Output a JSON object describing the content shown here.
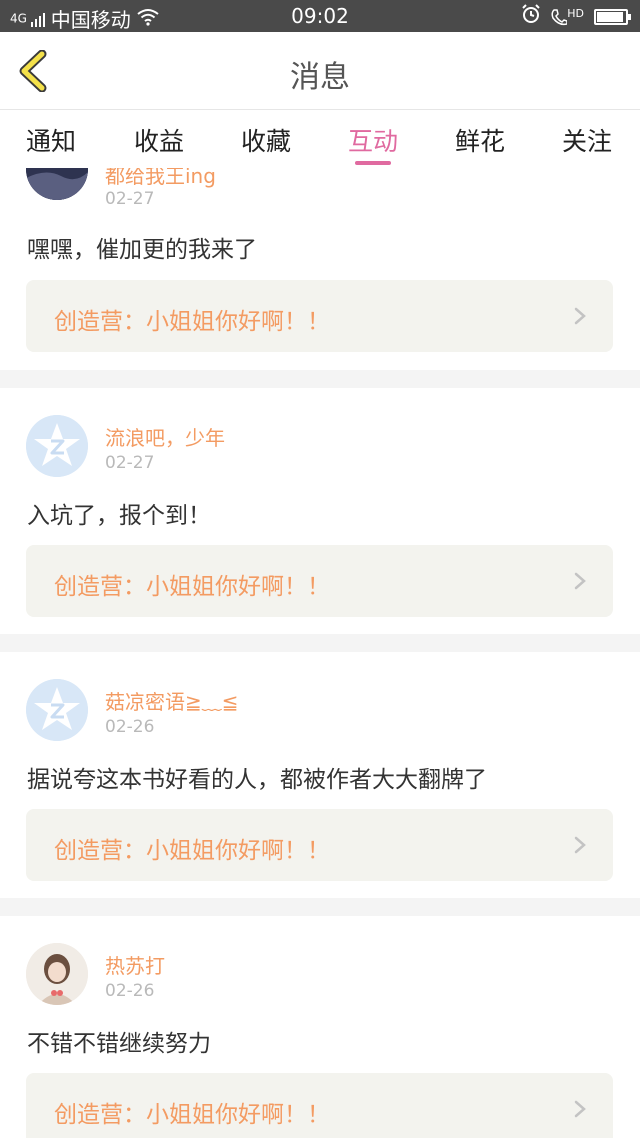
{
  "status_bar": {
    "network": "4G",
    "carrier": "中国移动",
    "time": "09:02",
    "hd_label": "HD",
    "battery_level": 0.85
  },
  "header": {
    "title": "消息",
    "back_icon": "chevron-left-icon"
  },
  "tabs": [
    {
      "label": "通知",
      "active": false
    },
    {
      "label": "收益",
      "active": false
    },
    {
      "label": "收藏",
      "active": false
    },
    {
      "label": "互动",
      "active": true
    },
    {
      "label": "鲜花",
      "active": false
    },
    {
      "label": "关注",
      "active": false
    }
  ],
  "colors": {
    "accent": "#e06aa0",
    "username": "#f39b62",
    "date": "#b9b9b9",
    "ref_bg": "#f3f3ee"
  },
  "comments": [
    {
      "username": "都给我王ing",
      "date": "02-27",
      "text": "嘿嘿，催加更的我来了",
      "ref": "创造营：小姐姐你好啊！！",
      "avatar": "photo-avatar"
    },
    {
      "username": "流浪吧，少年",
      "date": "02-27",
      "text": "入坑了，报个到！",
      "ref": "创造营：小姐姐你好啊！！",
      "avatar": "qq-default-avatar"
    },
    {
      "username": "菇凉密语≧﹏≦",
      "date": "02-26",
      "text": "据说夸这本书好看的人，都被作者大大翻牌了",
      "ref": "创造营：小姐姐你好啊！！",
      "avatar": "qq-default-avatar"
    },
    {
      "username": "热苏打",
      "date": "02-26",
      "text": "不错不错继续努力",
      "ref": "创造营：小姐姐你好啊！！",
      "avatar": "photo-avatar"
    }
  ]
}
